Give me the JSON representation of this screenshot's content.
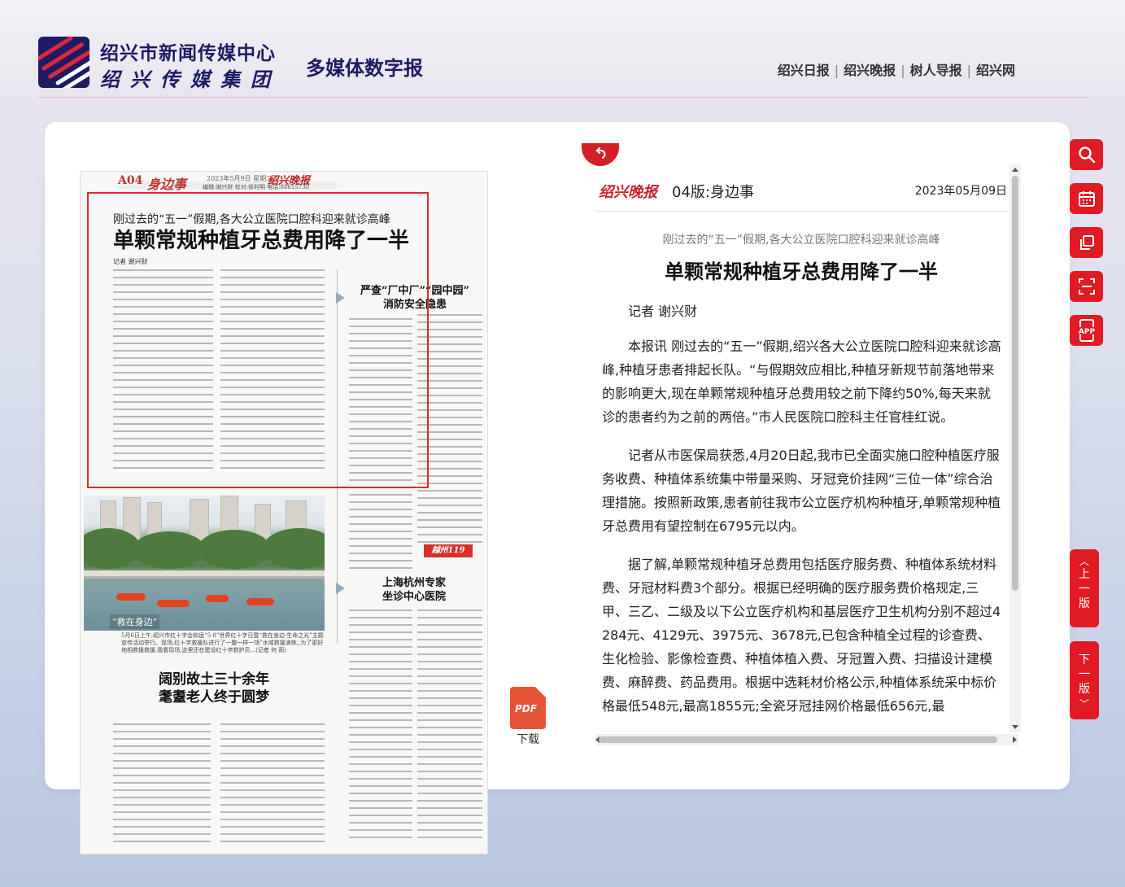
{
  "header": {
    "org_name": "绍兴市新闻传媒中心",
    "group_name": "绍兴传媒集团",
    "site_title": "多媒体数字报",
    "links": [
      "绍兴日报",
      "绍兴晚报",
      "树人导报",
      "绍兴网"
    ],
    "separator": "|"
  },
  "paper_page": {
    "page_code": "A04",
    "section": "身边事",
    "date_line": "2023年5月9日 星期二",
    "masthead": "绍兴晚报",
    "editor_line": "编辑:谢兴财 校对:徐利明 电话:88615738",
    "lead_subtitle": "刚过去的“五一”假期,各大公立医院口腔科迎来就诊高峰",
    "lead_title": "单颗常规种植牙总费用降了一半",
    "lead_byline": "记者 谢兴财",
    "side_story_1": "严查“厂中厂”“园中园”\n消防安全隐患",
    "side_story_2": "上海杭州专家\n坐诊中心医院",
    "photo_caption_overlay": "“救在身边”",
    "photo_caption": "5月6日上午,绍兴市红十字会和运“5·8”世界红十字日暨“救在身边·生命之光”主题宣传活动举行。现场,红十字救援队进行了一整一样一场”水域救援演练,,为了更好地相救援救援,我看现场,这里还在建设红十字救护员...(记者 何 雨)",
    "bottom_story": "阔别故土三十余年\n耄耋老人终于圆梦",
    "ad_label": "越州119"
  },
  "download": {
    "icon_text": "PDF",
    "label": "下载"
  },
  "article": {
    "masthead": "绍兴晚报",
    "edition": "04版:身边事",
    "date": "2023年05月09日",
    "subtitle": "刚过去的“五一”假期,各大公立医院口腔科迎来就诊高峰",
    "title": "单颗常规种植牙总费用降了一半",
    "author": "记者 谢兴财",
    "paragraphs": [
      "本报讯 刚过去的“五一”假期,绍兴各大公立医院口腔科迎来就诊高峰,种植牙患者排起长队。“与假期效应相比,种植牙新规节前落地带来的影响更大,现在单颗常规种植牙总费用较之前下降约50%,每天来就诊的患者约为之前的两倍。”市人民医院口腔科主任官桂红说。",
      "记者从市医保局获悉,4月20日起,我市已全面实施口腔种植医疗服务收费、种植体系统集中带量采购、牙冠竞价挂网“三位一体”综合治理措施。按照新政策,患者前往我市公立医疗机构种植牙,单颗常规种植牙总费用有望控制在6795元以内。",
      "据了解,单颗常规种植牙总费用包括医疗服务费、种植体系统材料费、牙冠材料费3个部分。根据已经明确的医疗服务费价格规定,三甲、三乙、二级及以下公立医疗机构和基层医疗卫生机构分别不超过4284元、4129元、3975元、3678元,已包含种植全过程的诊查费、生化检验、影像检查费、种植体植入费、牙冠置入费、扫描设计建模费、麻醉费、药品费用。根据中选耗材价格公示,种植体系统采中标价格最低548元,最高1855元;全瓷牙冠挂网价格最低656元,最"
    ]
  },
  "toolbar": {
    "items": [
      "search-icon",
      "calendar-icon",
      "copy-icon",
      "scan-icon",
      "app-icon"
    ],
    "app_label": "APP",
    "prev_page": "上一版",
    "next_page": "下一版"
  },
  "colors": {
    "accent": "#e01b23",
    "brand_navy": "#1d1b63",
    "highlight_box": "#e02a2a"
  }
}
